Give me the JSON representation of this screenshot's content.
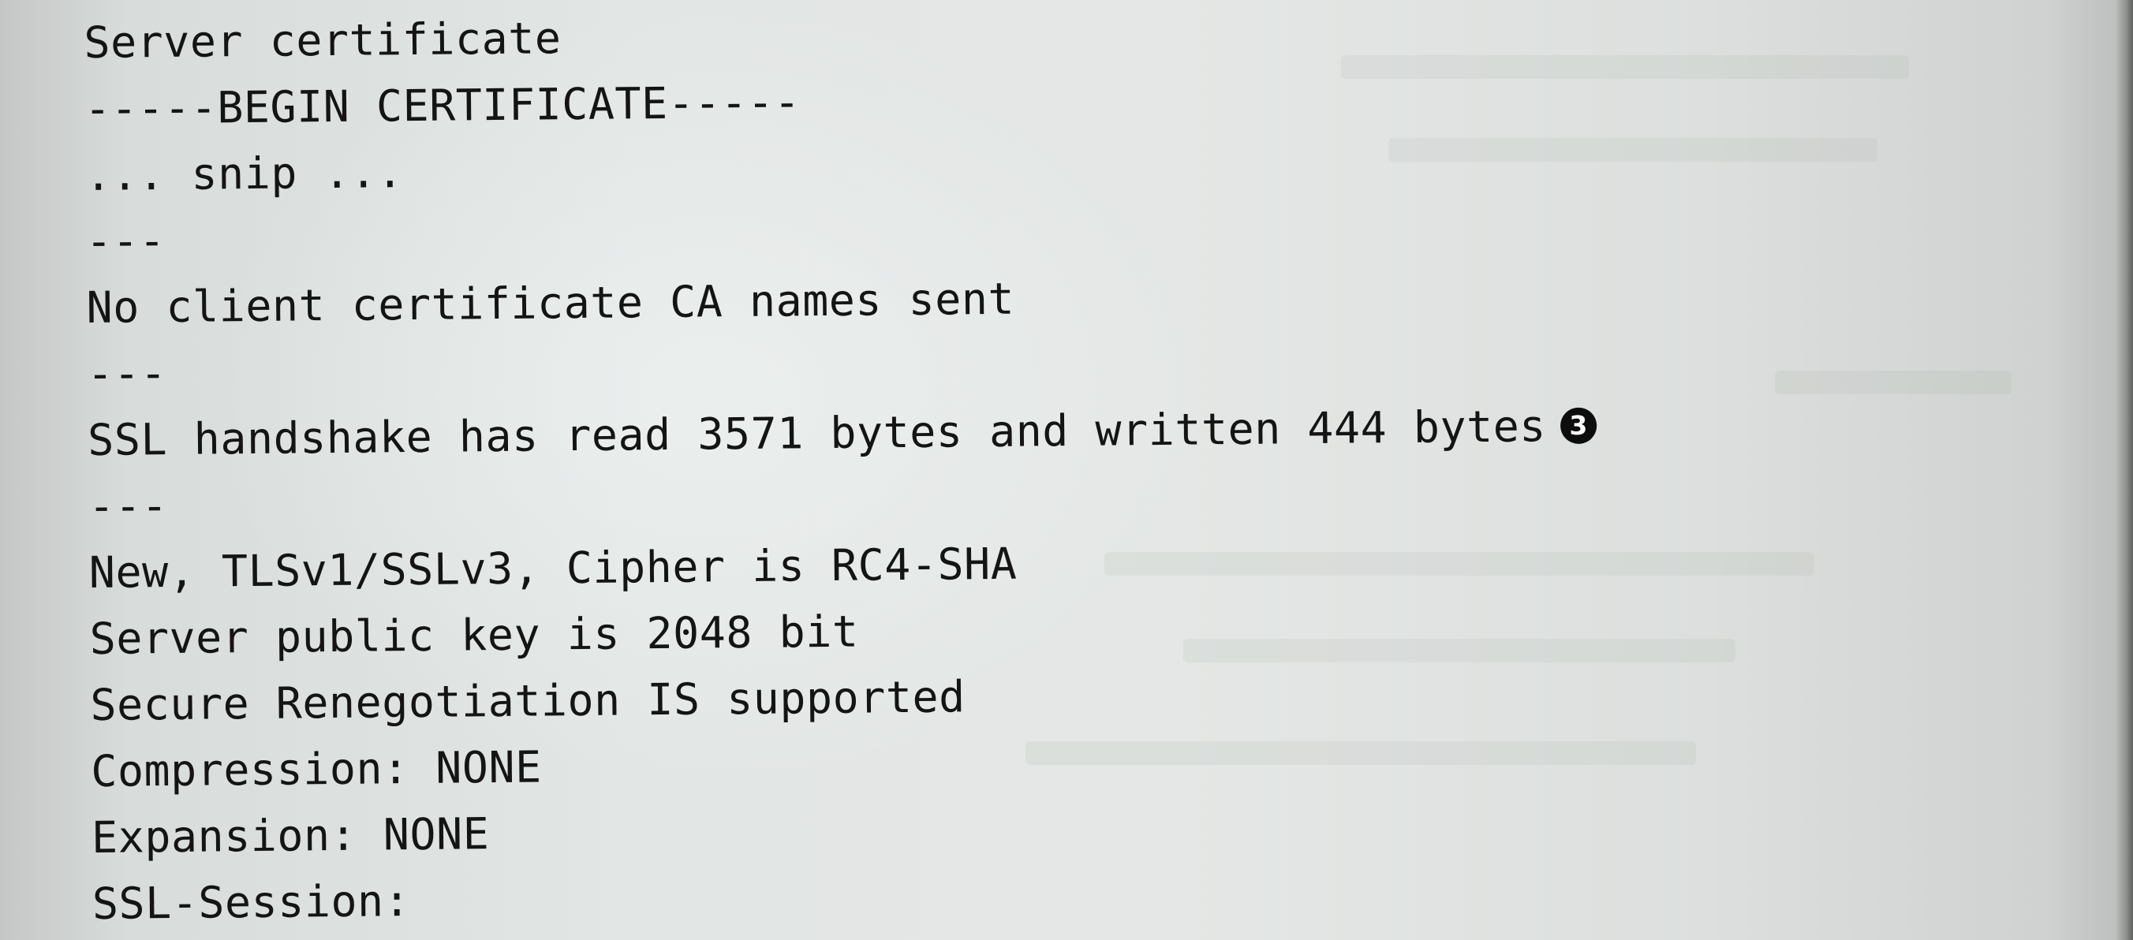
{
  "lines": [
    "Server certificate",
    "-----BEGIN CERTIFICATE-----",
    "... snip ...",
    "---",
    "No client certificate CA names sent",
    "---",
    "SSL handshake has read 3571 bytes and written 444 bytes",
    "---",
    "New, TLSv1/SSLv3, Cipher is RC4-SHA",
    "Server public key is 2048 bit",
    "Secure Renegotiation IS supported",
    "Compression: NONE",
    "Expansion: NONE",
    "SSL-Session:"
  ],
  "callout_marker": "3"
}
